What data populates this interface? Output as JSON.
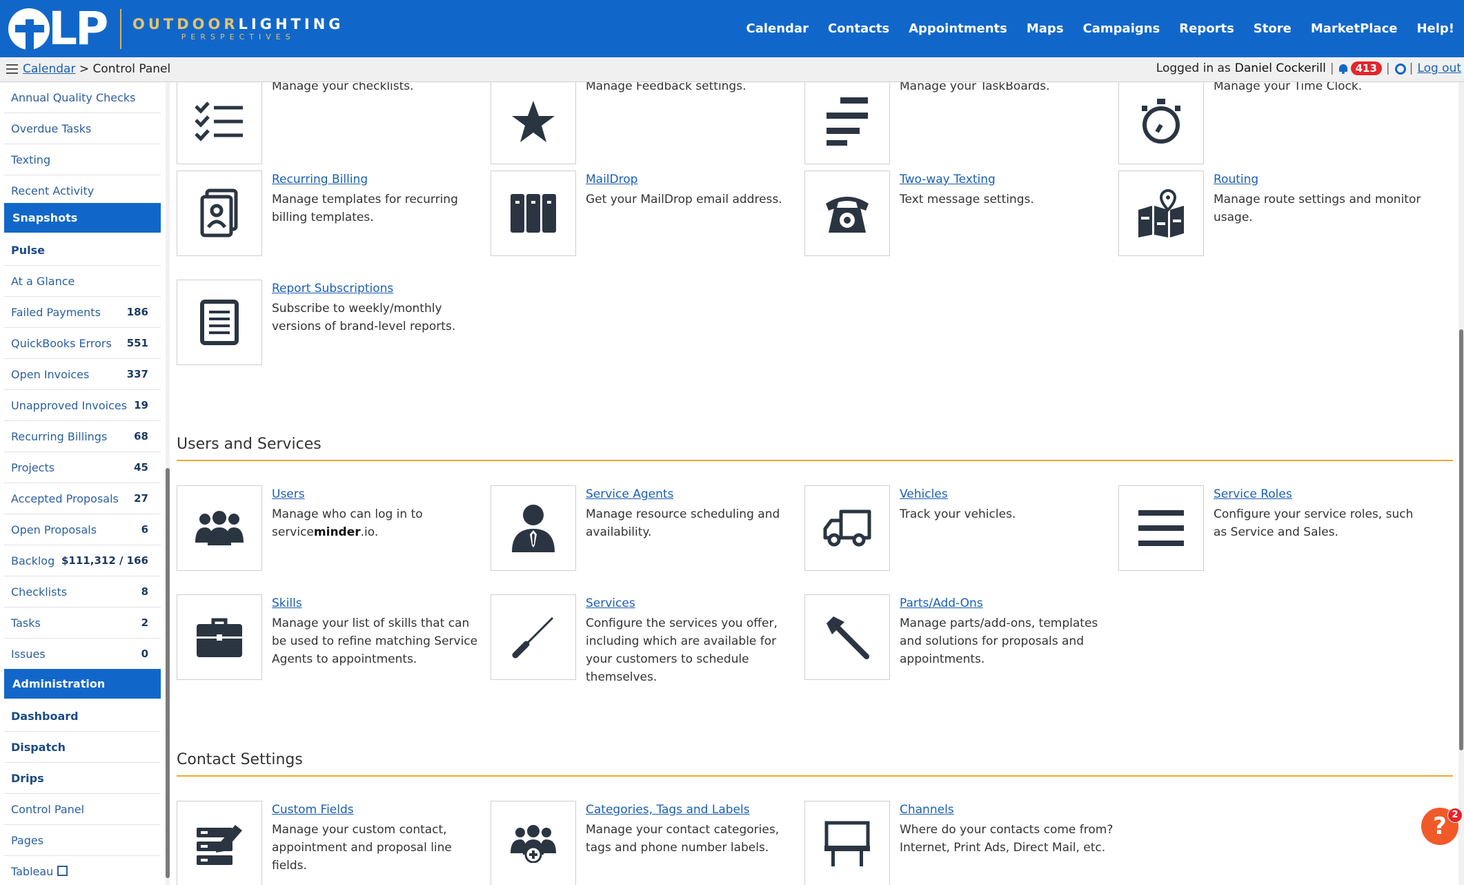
{
  "logo": {
    "mark": "LP",
    "line1_a": "OUTDOOR",
    "line1_b": "LIGHTING",
    "line2": "PERSPECTIVES"
  },
  "nav": [
    "Calendar",
    "Contacts",
    "Appointments",
    "Maps",
    "Campaigns",
    "Reports",
    "Store",
    "MarketPlace",
    "Help!"
  ],
  "breadcrumb": {
    "link": "Calendar",
    "sep": ">",
    "current": "Control Panel"
  },
  "user": {
    "prefix": "Logged in as",
    "name": "Daniel Cockerill",
    "notifications": "413",
    "logout": "Log out"
  },
  "sidebar": {
    "items_top": [
      "Annual Quality Checks",
      "Overdue Tasks",
      "Texting",
      "Recent Activity"
    ],
    "snapshots_header": "Snapshots",
    "snapshots": [
      {
        "label": "Pulse",
        "count": ""
      },
      {
        "label": "At a Glance",
        "count": ""
      },
      {
        "label": "Failed Payments",
        "count": "186"
      },
      {
        "label": "QuickBooks Errors",
        "count": "551"
      },
      {
        "label": "Open Invoices",
        "count": "337"
      },
      {
        "label": "Unapproved Invoices",
        "count": "19"
      },
      {
        "label": "Recurring Billings",
        "count": "68"
      },
      {
        "label": "Projects",
        "count": "45"
      },
      {
        "label": "Accepted Proposals",
        "count": "27"
      },
      {
        "label": "Open Proposals",
        "count": "6"
      },
      {
        "label": "Backlog",
        "count": "$111,312 / 166"
      },
      {
        "label": "Checklists",
        "count": "8"
      },
      {
        "label": "Tasks",
        "count": "2"
      },
      {
        "label": "Issues",
        "count": "0"
      }
    ],
    "admin_header": "Administration",
    "admin": [
      "Dashboard",
      "Dispatch",
      "Drips",
      "Control Panel",
      "Pages",
      "Tableau"
    ]
  },
  "tiles_partial": [
    {
      "desc": "Manage your checklists.",
      "icon": "checklist-icon"
    },
    {
      "desc": "Manage Feedback settings.",
      "icon": "star-icon"
    },
    {
      "desc": "Manage your TaskBoards.",
      "icon": "taskboard-icon"
    },
    {
      "desc": "Manage your Time Clock.",
      "icon": "stopwatch-icon"
    }
  ],
  "tiles_row2": [
    {
      "title": "Recurring Billing",
      "desc": "Manage templates for recurring billing templates.",
      "icon": "recurring-billing-icon"
    },
    {
      "title": "MailDrop",
      "desc": "Get your MailDrop email address.",
      "icon": "maildrop-icon"
    },
    {
      "title": "Two-way Texting",
      "desc": "Text message settings.",
      "icon": "phone-icon"
    },
    {
      "title": "Routing",
      "desc": "Manage route settings and monitor usage.",
      "icon": "map-icon"
    }
  ],
  "tiles_row3": [
    {
      "title": "Report Subscriptions",
      "desc": "Subscribe to weekly/monthly versions of brand-level reports.",
      "icon": "document-icon"
    }
  ],
  "section_users": {
    "title": "Users and Services",
    "tiles": [
      {
        "title": "Users",
        "desc_a": "Manage who can log in to service",
        "desc_b": "minder",
        "desc_c": ".io.",
        "icon": "users-icon"
      },
      {
        "title": "Service Agents",
        "desc": "Manage resource scheduling and availability.",
        "icon": "agent-icon"
      },
      {
        "title": "Vehicles",
        "desc": "Track your vehicles.",
        "icon": "truck-icon"
      },
      {
        "title": "Service Roles",
        "desc": "Configure your service roles, such as Service and Sales.",
        "icon": "roles-icon"
      },
      {
        "title": "Skills",
        "desc": "Manage your list of skills that can be used to refine matching Service Agents to appointments.",
        "icon": "briefcase-icon"
      },
      {
        "title": "Services",
        "desc": "Configure the services you offer, including which are available for your customers to schedule themselves.",
        "icon": "screwdriver-icon"
      },
      {
        "title": "Parts/Add-Ons",
        "desc": "Manage parts/add-ons, templates and solutions for proposals and appointments.",
        "icon": "hammer-icon"
      }
    ]
  },
  "section_contacts": {
    "title": "Contact Settings",
    "tiles": [
      {
        "title": "Custom Fields",
        "desc": "Manage your custom contact, appointment and proposal line fields.",
        "icon": "custom-fields-icon"
      },
      {
        "title": "Categories, Tags and Labels",
        "desc": "Manage your contact categories, tags and phone number labels.",
        "icon": "categories-icon"
      },
      {
        "title": "Channels",
        "desc": "Where do your contacts come from? Internet, Print Ads, Direct Mail, etc.",
        "icon": "billboard-icon"
      }
    ]
  },
  "help": {
    "glyph": "?",
    "count": "2"
  }
}
